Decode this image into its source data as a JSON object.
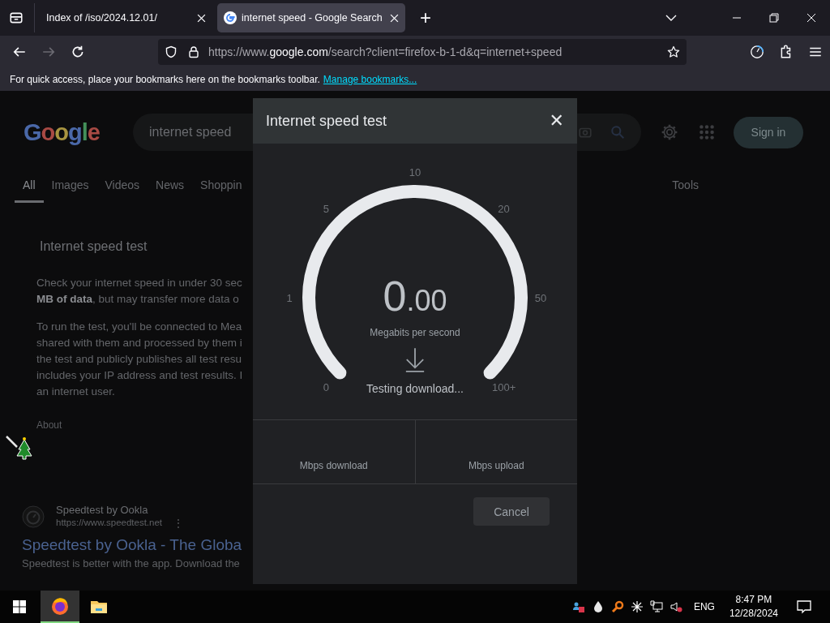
{
  "browser": {
    "tabs": [
      {
        "title": "Index of /iso/2024.12.01/",
        "selected": false,
        "favicon": false
      },
      {
        "title": "internet speed - Google Search",
        "selected": true,
        "favicon": true
      }
    ],
    "new_tab": "+",
    "url_prefix": "https://www.",
    "url_domain": "google.com",
    "url_rest": "/search?client=firefox-b-1-d&q=internet+speed",
    "bookmarks_message": "For quick access, place your bookmarks here on the bookmarks toolbar.",
    "bookmarks_link": "Manage bookmarks..."
  },
  "page": {
    "logo": "Google",
    "search_value": "internet speed",
    "sign_in": "Sign in",
    "tabs": [
      {
        "label": "All",
        "selected": true
      },
      {
        "label": "Images",
        "selected": false
      },
      {
        "label": "Videos",
        "selected": false
      },
      {
        "label": "News",
        "selected": false
      },
      {
        "label": "Shoppin",
        "selected": false
      }
    ],
    "tools": "Tools",
    "card_title": "Internet speed test",
    "para1": [
      "Check your internet speed in under 30 sec",
      "**MB of data**, but may transfer more data o"
    ],
    "para2": [
      "To run the test, you'll be connected to Mea",
      "shared with them and processed by them i",
      "the test and publicly publishes all test resu",
      "includes your IP address and test results. I",
      "an internet user."
    ],
    "about": "About",
    "result": {
      "site": "Speedtest by Ookla",
      "url": "https://www.speedtest.net",
      "more": "⋮",
      "title": "Speedtest by Ookla - The Globa",
      "snippet": "Speedtest is better with the app. Download the"
    }
  },
  "dialog": {
    "title": "Internet speed test",
    "close": "✕",
    "gauge": {
      "ticks": [
        "0",
        "1",
        "5",
        "10",
        "20",
        "50",
        "100+"
      ]
    },
    "value": "0",
    "value_decimals": ".00",
    "unit": "Megabits per second",
    "status": "Testing download...",
    "results": [
      "Mbps download",
      "Mbps upload"
    ],
    "cancel": "Cancel"
  },
  "taskbar": {
    "apps": [
      {
        "kind": "firefox",
        "active": true
      },
      {
        "kind": "explorer",
        "active": false
      }
    ],
    "language": "ENG",
    "time": "8:47 PM",
    "date": "12/28/2024"
  }
}
